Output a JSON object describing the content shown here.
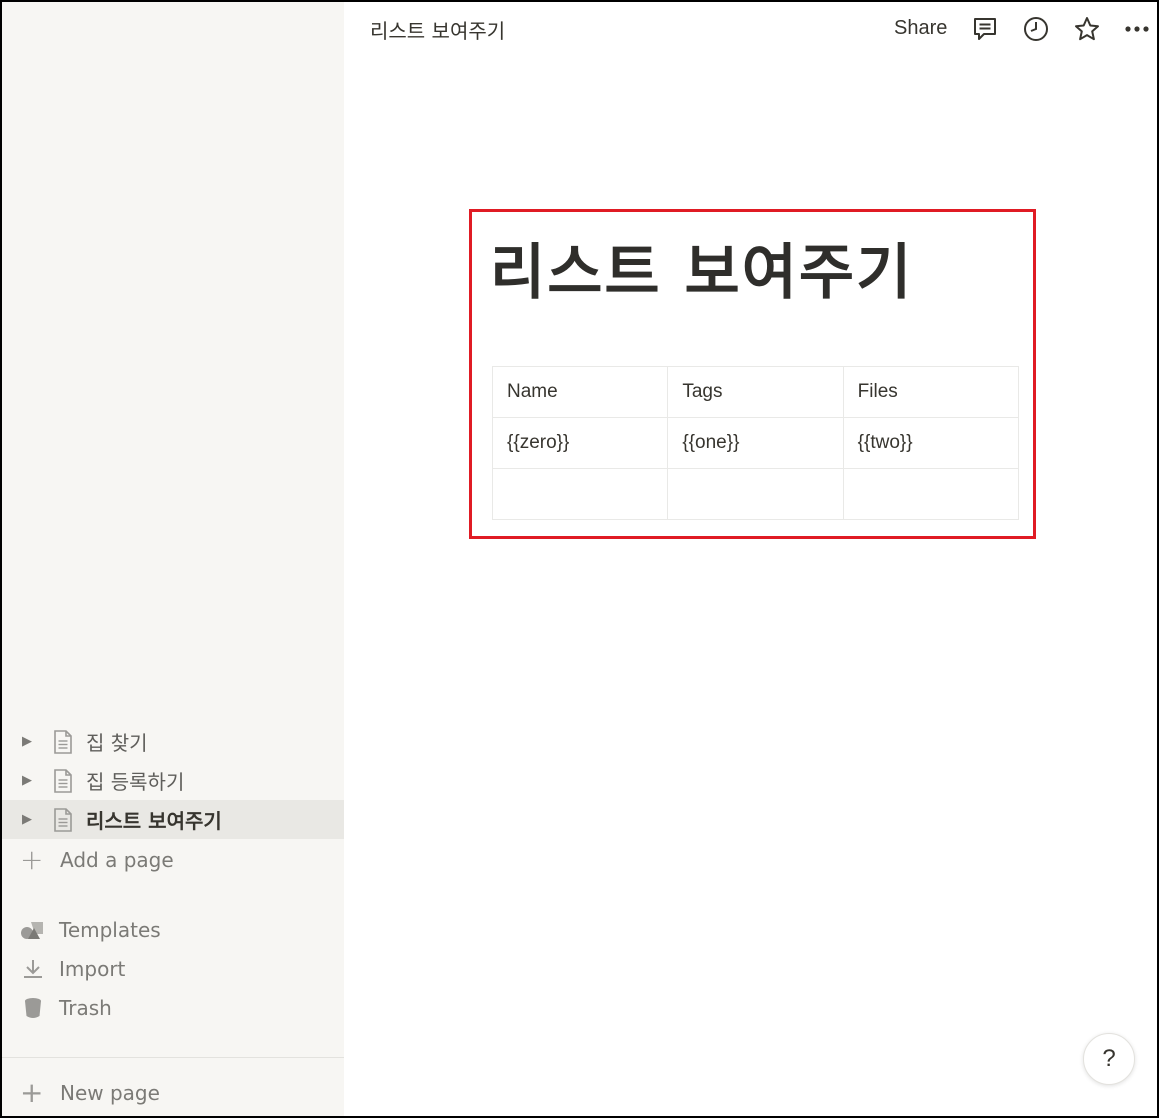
{
  "topbar": {
    "breadcrumb": "리스트 보여주기",
    "share_label": "Share",
    "icons": [
      "comment-icon",
      "clock-icon",
      "star-icon",
      "more-icon"
    ]
  },
  "sidebar": {
    "pages": [
      {
        "label": "집 찾기",
        "active": false
      },
      {
        "label": "집 등록하기",
        "active": false
      },
      {
        "label": "리스트 보여주기",
        "active": true
      }
    ],
    "add_page_label": "Add a page",
    "tools": [
      {
        "label": "Templates",
        "icon": "templates-icon"
      },
      {
        "label": "Import",
        "icon": "download-icon"
      },
      {
        "label": "Trash",
        "icon": "trash-icon"
      }
    ],
    "new_page_label": "New page"
  },
  "page": {
    "title": "리스트 보여주기",
    "table": {
      "headers": [
        "Name",
        "Tags",
        "Files"
      ],
      "rows": [
        [
          "{{zero}}",
          "{{one}}",
          "{{two}}"
        ],
        [
          "",
          "",
          ""
        ]
      ]
    }
  },
  "help_label": "?",
  "colors": {
    "highlight_border": "#e01b24",
    "sidebar_bg": "#f7f6f3",
    "active_item_bg": "#e9e8e4"
  }
}
